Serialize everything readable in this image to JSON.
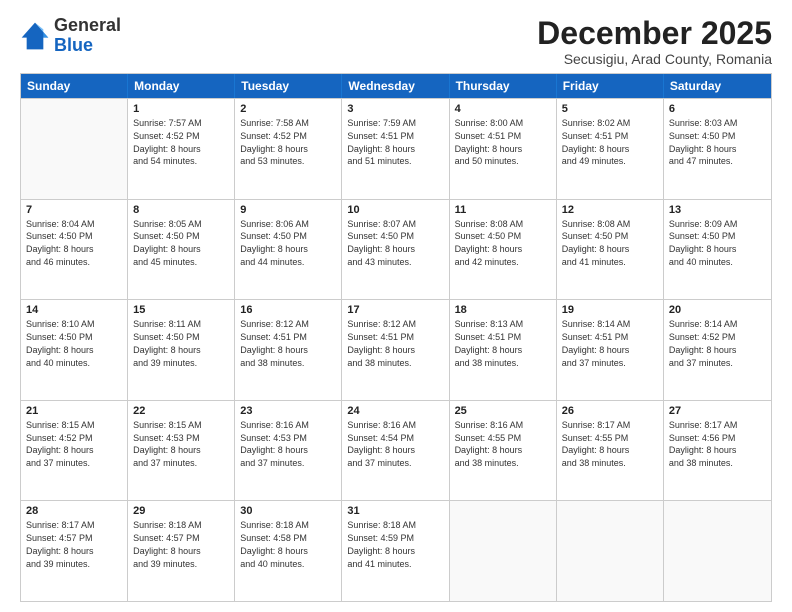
{
  "logo": {
    "general": "General",
    "blue": "Blue"
  },
  "title": "December 2025",
  "location": "Secusigiu, Arad County, Romania",
  "weekdays": [
    "Sunday",
    "Monday",
    "Tuesday",
    "Wednesday",
    "Thursday",
    "Friday",
    "Saturday"
  ],
  "rows": [
    [
      {
        "day": "",
        "info": ""
      },
      {
        "day": "1",
        "info": "Sunrise: 7:57 AM\nSunset: 4:52 PM\nDaylight: 8 hours\nand 54 minutes."
      },
      {
        "day": "2",
        "info": "Sunrise: 7:58 AM\nSunset: 4:52 PM\nDaylight: 8 hours\nand 53 minutes."
      },
      {
        "day": "3",
        "info": "Sunrise: 7:59 AM\nSunset: 4:51 PM\nDaylight: 8 hours\nand 51 minutes."
      },
      {
        "day": "4",
        "info": "Sunrise: 8:00 AM\nSunset: 4:51 PM\nDaylight: 8 hours\nand 50 minutes."
      },
      {
        "day": "5",
        "info": "Sunrise: 8:02 AM\nSunset: 4:51 PM\nDaylight: 8 hours\nand 49 minutes."
      },
      {
        "day": "6",
        "info": "Sunrise: 8:03 AM\nSunset: 4:50 PM\nDaylight: 8 hours\nand 47 minutes."
      }
    ],
    [
      {
        "day": "7",
        "info": "Sunrise: 8:04 AM\nSunset: 4:50 PM\nDaylight: 8 hours\nand 46 minutes."
      },
      {
        "day": "8",
        "info": "Sunrise: 8:05 AM\nSunset: 4:50 PM\nDaylight: 8 hours\nand 45 minutes."
      },
      {
        "day": "9",
        "info": "Sunrise: 8:06 AM\nSunset: 4:50 PM\nDaylight: 8 hours\nand 44 minutes."
      },
      {
        "day": "10",
        "info": "Sunrise: 8:07 AM\nSunset: 4:50 PM\nDaylight: 8 hours\nand 43 minutes."
      },
      {
        "day": "11",
        "info": "Sunrise: 8:08 AM\nSunset: 4:50 PM\nDaylight: 8 hours\nand 42 minutes."
      },
      {
        "day": "12",
        "info": "Sunrise: 8:08 AM\nSunset: 4:50 PM\nDaylight: 8 hours\nand 41 minutes."
      },
      {
        "day": "13",
        "info": "Sunrise: 8:09 AM\nSunset: 4:50 PM\nDaylight: 8 hours\nand 40 minutes."
      }
    ],
    [
      {
        "day": "14",
        "info": "Sunrise: 8:10 AM\nSunset: 4:50 PM\nDaylight: 8 hours\nand 40 minutes."
      },
      {
        "day": "15",
        "info": "Sunrise: 8:11 AM\nSunset: 4:50 PM\nDaylight: 8 hours\nand 39 minutes."
      },
      {
        "day": "16",
        "info": "Sunrise: 8:12 AM\nSunset: 4:51 PM\nDaylight: 8 hours\nand 38 minutes."
      },
      {
        "day": "17",
        "info": "Sunrise: 8:12 AM\nSunset: 4:51 PM\nDaylight: 8 hours\nand 38 minutes."
      },
      {
        "day": "18",
        "info": "Sunrise: 8:13 AM\nSunset: 4:51 PM\nDaylight: 8 hours\nand 38 minutes."
      },
      {
        "day": "19",
        "info": "Sunrise: 8:14 AM\nSunset: 4:51 PM\nDaylight: 8 hours\nand 37 minutes."
      },
      {
        "day": "20",
        "info": "Sunrise: 8:14 AM\nSunset: 4:52 PM\nDaylight: 8 hours\nand 37 minutes."
      }
    ],
    [
      {
        "day": "21",
        "info": "Sunrise: 8:15 AM\nSunset: 4:52 PM\nDaylight: 8 hours\nand 37 minutes."
      },
      {
        "day": "22",
        "info": "Sunrise: 8:15 AM\nSunset: 4:53 PM\nDaylight: 8 hours\nand 37 minutes."
      },
      {
        "day": "23",
        "info": "Sunrise: 8:16 AM\nSunset: 4:53 PM\nDaylight: 8 hours\nand 37 minutes."
      },
      {
        "day": "24",
        "info": "Sunrise: 8:16 AM\nSunset: 4:54 PM\nDaylight: 8 hours\nand 37 minutes."
      },
      {
        "day": "25",
        "info": "Sunrise: 8:16 AM\nSunset: 4:55 PM\nDaylight: 8 hours\nand 38 minutes."
      },
      {
        "day": "26",
        "info": "Sunrise: 8:17 AM\nSunset: 4:55 PM\nDaylight: 8 hours\nand 38 minutes."
      },
      {
        "day": "27",
        "info": "Sunrise: 8:17 AM\nSunset: 4:56 PM\nDaylight: 8 hours\nand 38 minutes."
      }
    ],
    [
      {
        "day": "28",
        "info": "Sunrise: 8:17 AM\nSunset: 4:57 PM\nDaylight: 8 hours\nand 39 minutes."
      },
      {
        "day": "29",
        "info": "Sunrise: 8:18 AM\nSunset: 4:57 PM\nDaylight: 8 hours\nand 39 minutes."
      },
      {
        "day": "30",
        "info": "Sunrise: 8:18 AM\nSunset: 4:58 PM\nDaylight: 8 hours\nand 40 minutes."
      },
      {
        "day": "31",
        "info": "Sunrise: 8:18 AM\nSunset: 4:59 PM\nDaylight: 8 hours\nand 41 minutes."
      },
      {
        "day": "",
        "info": ""
      },
      {
        "day": "",
        "info": ""
      },
      {
        "day": "",
        "info": ""
      }
    ]
  ]
}
